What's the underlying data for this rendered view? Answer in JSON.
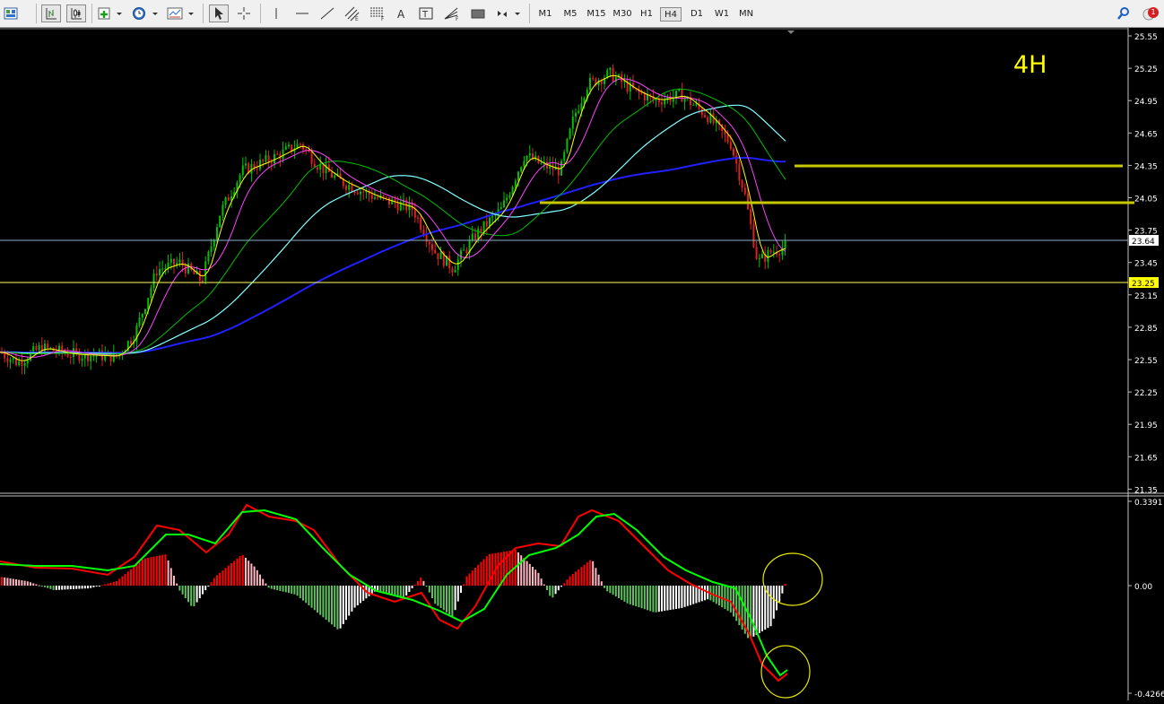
{
  "toolbar": {
    "timeframes": [
      {
        "label": "M1",
        "active": false
      },
      {
        "label": "M5",
        "active": false
      },
      {
        "label": "M15",
        "active": false
      },
      {
        "label": "M30",
        "active": false
      },
      {
        "label": "H1",
        "active": false
      },
      {
        "label": "H4",
        "active": true
      },
      {
        "label": "D1",
        "active": false
      },
      {
        "label": "W1",
        "active": false
      },
      {
        "label": "MN",
        "active": false
      }
    ],
    "notification_count": "1",
    "icons": [
      "profiles-icon",
      "bar-chart-icon",
      "candlestick-icon",
      "new-chart-icon",
      "clock-icon",
      "indicators-icon",
      "cursor-icon",
      "crosshair-icon",
      "vertical-line-icon",
      "horizontal-line-icon",
      "trendline-icon",
      "equidistant-channel-icon",
      "fibonacci-retracement-icon",
      "text-icon",
      "text-label-icon",
      "fibonacci-fan-icon",
      "rectangle-icon",
      "arrows-icon",
      "search-icon"
    ]
  },
  "main_chart": {
    "annotation": "4H",
    "price_labels": [
      "25.55",
      "25.25",
      "24.95",
      "24.65",
      "24.35",
      "24.05",
      "23.75",
      "23.45",
      "23.15",
      "22.85",
      "22.55",
      "22.25",
      "21.95",
      "21.65",
      "21.35"
    ],
    "current_price": "23.64",
    "horizontal_line_price": "23.25",
    "colors": {
      "bull": "#00c000",
      "bear": "#e02020",
      "ma_fast": "#ffff00",
      "ma_magenta": "#ff40ff",
      "ma_green": "#00c000",
      "ma_cyan": "#80ffff",
      "ma_blue": "#2020ff",
      "level_line": "#c8c800",
      "annotation": "#ffff00"
    }
  },
  "indicator": {
    "labels": [
      "0.3391",
      "0.00",
      "-0.4266"
    ],
    "colors": {
      "line_red": "#ff0000",
      "line_green": "#00ff00",
      "hist_red": "#ff0000",
      "hist_pink": "#ffb6c1",
      "hist_green": "#60c060",
      "hist_white": "#ffffff",
      "circle": "#e8e800"
    }
  }
}
